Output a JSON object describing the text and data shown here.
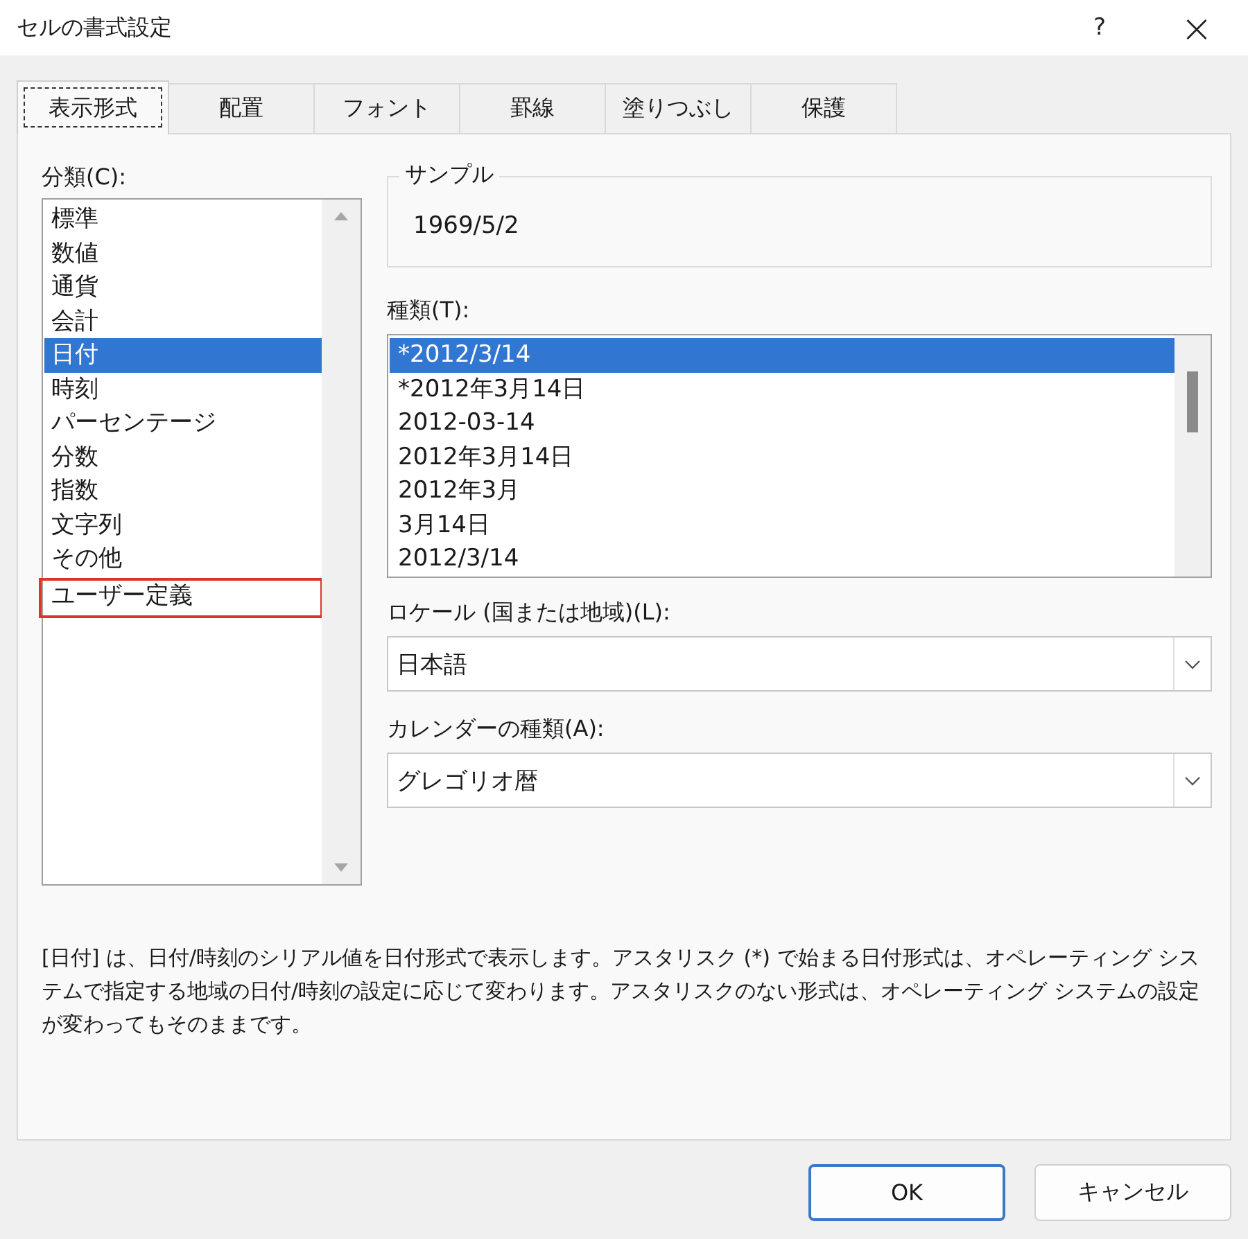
{
  "window": {
    "title": "セルの書式設定",
    "help": "?",
    "close": "×"
  },
  "tabs": [
    {
      "label": "表示形式",
      "selected": true
    },
    {
      "label": "配置",
      "selected": false
    },
    {
      "label": "フォント",
      "selected": false
    },
    {
      "label": "罫線",
      "selected": false
    },
    {
      "label": "塗りつぶし",
      "selected": false
    },
    {
      "label": "保護",
      "selected": false
    }
  ],
  "category": {
    "label": "分類(C):",
    "items": [
      {
        "label": "標準",
        "selected": false,
        "highlighted": false
      },
      {
        "label": "数値",
        "selected": false,
        "highlighted": false
      },
      {
        "label": "通貨",
        "selected": false,
        "highlighted": false
      },
      {
        "label": "会計",
        "selected": false,
        "highlighted": false
      },
      {
        "label": "日付",
        "selected": true,
        "highlighted": false
      },
      {
        "label": "時刻",
        "selected": false,
        "highlighted": false
      },
      {
        "label": "パーセンテージ",
        "selected": false,
        "highlighted": false
      },
      {
        "label": "分数",
        "selected": false,
        "highlighted": false
      },
      {
        "label": "指数",
        "selected": false,
        "highlighted": false
      },
      {
        "label": "文字列",
        "selected": false,
        "highlighted": false
      },
      {
        "label": "その他",
        "selected": false,
        "highlighted": false
      },
      {
        "label": "ユーザー定義",
        "selected": false,
        "highlighted": true
      }
    ]
  },
  "sample": {
    "label": "サンプル",
    "value": "1969/5/2"
  },
  "type": {
    "label": "種類(T):",
    "items": [
      {
        "label": "*2012/3/14",
        "selected": true
      },
      {
        "label": "*2012年3月14日",
        "selected": false
      },
      {
        "label": "2012-03-14",
        "selected": false
      },
      {
        "label": "2012年3月14日",
        "selected": false
      },
      {
        "label": "2012年3月",
        "selected": false
      },
      {
        "label": "3月14日",
        "selected": false
      },
      {
        "label": "2012/3/14",
        "selected": false
      }
    ]
  },
  "locale": {
    "label": "ロケール (国または地域)(L):",
    "value": "日本語"
  },
  "calendar": {
    "label": "カレンダーの種類(A):",
    "value": "グレゴリオ暦"
  },
  "description": "[日付] は、日付/時刻のシリアル値を日付形式で表示します。アスタリスク (*) で始まる日付形式は、オペレーティング システムで指定する地域の日付/時刻の設定に応じて変わります。アスタリスクのない形式は、オペレーティング システムの設定が変わってもそのままです。",
  "buttons": [
    {
      "label": "OK",
      "kind": "default"
    },
    {
      "label": "キャンセル",
      "kind": "normal"
    }
  ]
}
